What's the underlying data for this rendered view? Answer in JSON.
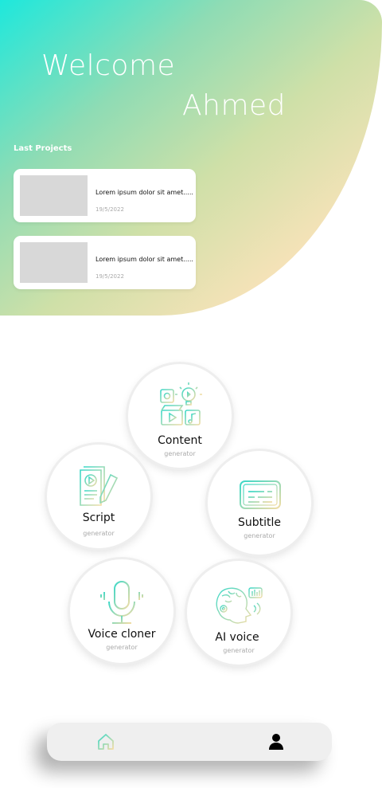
{
  "header": {
    "welcome_text": "Welcome",
    "user_name": "Ahmed",
    "section_title": "Last Projects"
  },
  "projects": [
    {
      "title": "Lorem ipsum dolor sit amet.....",
      "date": "19/5/2022"
    },
    {
      "title": "Lorem ipsum dolor sit amet.....",
      "date": "19/5/2022"
    }
  ],
  "tools": {
    "content": {
      "label": "Content",
      "sub": "generator",
      "icon": "content-media-icon"
    },
    "script": {
      "label": "Script",
      "sub": "generator",
      "icon": "script-document-icon"
    },
    "subtitle": {
      "label": "Subtitle",
      "sub": "generator",
      "icon": "subtitle-icon"
    },
    "voice_cloner": {
      "label": "Voice cloner",
      "sub": "generator",
      "icon": "microphone-icon"
    },
    "ai_voice": {
      "label": "AI voice",
      "sub": "generator",
      "icon": "robot-head-voice-icon"
    }
  },
  "nav": {
    "home_icon": "home-icon",
    "profile_icon": "user-icon"
  },
  "colors": {
    "gradient_start": "#1ee8dc",
    "gradient_end": "#fee8c9",
    "icon_teal": "#4fd6c4",
    "icon_cream": "#f5dfa6"
  }
}
